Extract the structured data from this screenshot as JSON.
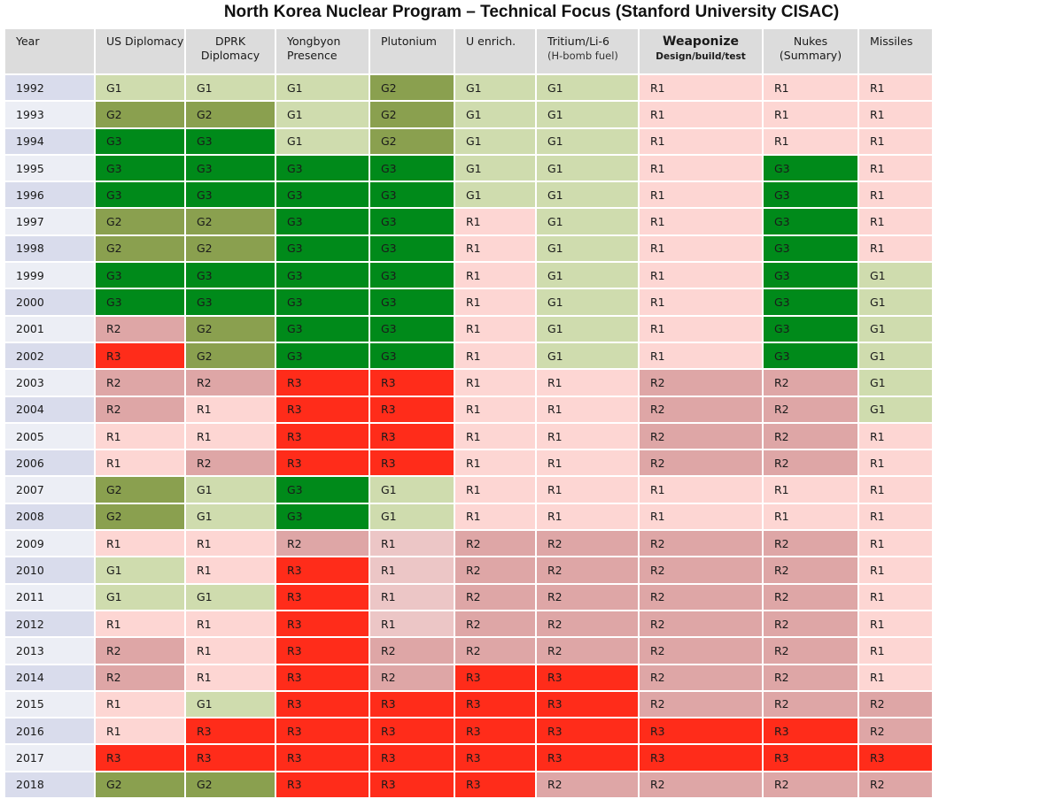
{
  "chart_data": {
    "type": "table",
    "title": "North Korea Nuclear Program – Technical Focus (Stanford University CISAC)",
    "columns": [
      {
        "key": "year",
        "label": "Year",
        "sub": ""
      },
      {
        "key": "us_diplomacy",
        "label": "US Diplomacy",
        "sub": ""
      },
      {
        "key": "dprk_diplomacy",
        "label": "DPRK",
        "sub": "Diplomacy"
      },
      {
        "key": "yongbyon",
        "label": "Yongbyon",
        "sub": "Presence"
      },
      {
        "key": "plutonium",
        "label": "Plutonium",
        "sub": ""
      },
      {
        "key": "u_enrich",
        "label": "U enrich.",
        "sub": ""
      },
      {
        "key": "tritium",
        "label": "Tritium/Li-6",
        "sub": "(H-bomb fuel)"
      },
      {
        "key": "weaponize",
        "label": "Weaponize",
        "sub": "Design/build/test"
      },
      {
        "key": "nukes",
        "label": "Nukes",
        "sub": "(Summary)"
      },
      {
        "key": "missiles",
        "label": "Missiles",
        "sub": ""
      }
    ],
    "legend": {
      "G1": {
        "meaning": "light green",
        "color": "#cfdcae"
      },
      "G2": {
        "meaning": "olive green",
        "color": "#8aa04f"
      },
      "G3": {
        "meaning": "dark green",
        "color": "#008a1a"
      },
      "R1": {
        "meaning": "light red",
        "color": "#fdd6d3"
      },
      "R2": {
        "meaning": "medium red",
        "color": "#dea6a6"
      },
      "R3": {
        "meaning": "bright red",
        "color": "#ff2c1a"
      }
    },
    "variant_colors": {
      "plutonium_R1_2009_2012": "#ecc6c6"
    },
    "rows": [
      {
        "year": "1992",
        "values": [
          "G1",
          "G1",
          "G1",
          "G2",
          "G1",
          "G1",
          "R1",
          "R1",
          "R1"
        ]
      },
      {
        "year": "1993",
        "values": [
          "G2",
          "G2",
          "G1",
          "G2",
          "G1",
          "G1",
          "R1",
          "R1",
          "R1"
        ]
      },
      {
        "year": "1994",
        "values": [
          "G3",
          "G3",
          "G1",
          "G2",
          "G1",
          "G1",
          "R1",
          "R1",
          "R1"
        ]
      },
      {
        "year": "1995",
        "values": [
          "G3",
          "G3",
          "G3",
          "G3",
          "G1",
          "G1",
          "R1",
          "G3",
          "R1"
        ]
      },
      {
        "year": "1996",
        "values": [
          "G3",
          "G3",
          "G3",
          "G3",
          "G1",
          "G1",
          "R1",
          "G3",
          "R1"
        ]
      },
      {
        "year": "1997",
        "values": [
          "G2",
          "G2",
          "G3",
          "G3",
          "R1",
          "G1",
          "R1",
          "G3",
          "R1"
        ]
      },
      {
        "year": "1998",
        "values": [
          "G2",
          "G2",
          "G3",
          "G3",
          "R1",
          "G1",
          "R1",
          "G3",
          "R1"
        ]
      },
      {
        "year": "1999",
        "values": [
          "G3",
          "G3",
          "G3",
          "G3",
          "R1",
          "G1",
          "R1",
          "G3",
          "G1"
        ]
      },
      {
        "year": "2000",
        "values": [
          "G3",
          "G3",
          "G3",
          "G3",
          "R1",
          "G1",
          "R1",
          "G3",
          "G1"
        ]
      },
      {
        "year": "2001",
        "values": [
          "R2",
          "G2",
          "G3",
          "G3",
          "R1",
          "G1",
          "R1",
          "G3",
          "G1"
        ]
      },
      {
        "year": "2002",
        "values": [
          "R3",
          "G2",
          "G3",
          "G3",
          "R1",
          "G1",
          "R1",
          "G3",
          "G1"
        ]
      },
      {
        "year": "2003",
        "values": [
          "R2",
          "R2",
          "R3",
          "R3",
          "R1",
          "R1",
          "R2",
          "R2",
          "G1"
        ]
      },
      {
        "year": "2004",
        "values": [
          "R2",
          "R1",
          "R3",
          "R3",
          "R1",
          "R1",
          "R2",
          "R2",
          "G1"
        ]
      },
      {
        "year": "2005",
        "values": [
          "R1",
          "R1",
          "R3",
          "R3",
          "R1",
          "R1",
          "R2",
          "R2",
          "R1"
        ]
      },
      {
        "year": "2006",
        "values": [
          "R1",
          "R2",
          "R3",
          "R3",
          "R1",
          "R1",
          "R2",
          "R2",
          "R1"
        ]
      },
      {
        "year": "2007",
        "values": [
          "G2",
          "G1",
          "G3",
          "G1",
          "R1",
          "R1",
          "R1",
          "R1",
          "R1"
        ]
      },
      {
        "year": "2008",
        "values": [
          "G2",
          "G1",
          "G3",
          "G1",
          "R1",
          "R1",
          "R1",
          "R1",
          "R1"
        ]
      },
      {
        "year": "2009",
        "values": [
          "R1",
          "R1",
          "R2",
          "R1",
          "R2",
          "R2",
          "R2",
          "R2",
          "R1"
        ]
      },
      {
        "year": "2010",
        "values": [
          "G1",
          "R1",
          "R3",
          "R1",
          "R2",
          "R2",
          "R2",
          "R2",
          "R1"
        ]
      },
      {
        "year": "2011",
        "values": [
          "G1",
          "G1",
          "R3",
          "R1",
          "R2",
          "R2",
          "R2",
          "R2",
          "R1"
        ]
      },
      {
        "year": "2012",
        "values": [
          "R1",
          "R1",
          "R3",
          "R1",
          "R2",
          "R2",
          "R2",
          "R2",
          "R1"
        ]
      },
      {
        "year": "2013",
        "values": [
          "R2",
          "R1",
          "R3",
          "R2",
          "R2",
          "R2",
          "R2",
          "R2",
          "R1"
        ]
      },
      {
        "year": "2014",
        "values": [
          "R2",
          "R1",
          "R3",
          "R2",
          "R3",
          "R3",
          "R2",
          "R2",
          "R1"
        ]
      },
      {
        "year": "2015",
        "values": [
          "R1",
          "G1",
          "R3",
          "R3",
          "R3",
          "R3",
          "R2",
          "R2",
          "R2"
        ]
      },
      {
        "year": "2016",
        "values": [
          "R1",
          "R3",
          "R3",
          "R3",
          "R3",
          "R3",
          "R3",
          "R3",
          "R2"
        ]
      },
      {
        "year": "2017",
        "values": [
          "R3",
          "R3",
          "R3",
          "R3",
          "R3",
          "R3",
          "R3",
          "R3",
          "R3"
        ]
      },
      {
        "year": "2018",
        "values": [
          "G2",
          "G2",
          "R3",
          "R3",
          "R3",
          "R2",
          "R2",
          "R2",
          "R2"
        ]
      }
    ]
  }
}
